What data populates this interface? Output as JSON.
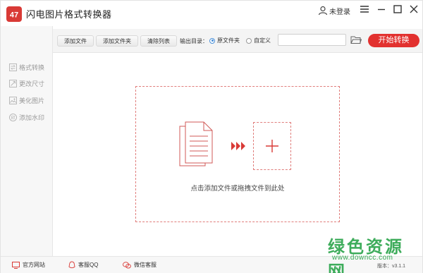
{
  "app": {
    "title": "闪电图片格式转换器"
  },
  "header": {
    "user_label": "未登录",
    "icons": {
      "user": "user-icon",
      "menu": "menu-icon",
      "minimize": "minimize-icon",
      "maximize": "maximize-icon",
      "close": "close-icon"
    }
  },
  "toolbar": {
    "add_file": "添加文件",
    "add_folder": "添加文件夹",
    "clear_list": "清除列表",
    "output_dir_label": "输出目录：",
    "radio_original": "原文件夹",
    "radio_custom": "自定义",
    "selected_radio": "原文件夹",
    "path_value": "",
    "start": "开始转换"
  },
  "sidebar": {
    "items": [
      {
        "label": "格式转换",
        "icon": "convert-icon"
      },
      {
        "label": "更改尺寸",
        "icon": "resize-icon"
      },
      {
        "label": "美化图片",
        "icon": "image-icon"
      },
      {
        "label": "添加水印",
        "icon": "watermark-icon"
      }
    ]
  },
  "main": {
    "drop_hint": "点击添加文件或拖拽文件到此处"
  },
  "status": {
    "website": "官方网站",
    "qq": "客服QQ",
    "wechat": "微信客服",
    "version": "版本：v3.1.1"
  },
  "watermark": {
    "main": "绿色资源网",
    "sub": "www.downcc.com"
  },
  "colors": {
    "accent": "#e2312f",
    "logo": "#d93a36",
    "dash": "#e07d7b",
    "watermark": "#34a853"
  }
}
